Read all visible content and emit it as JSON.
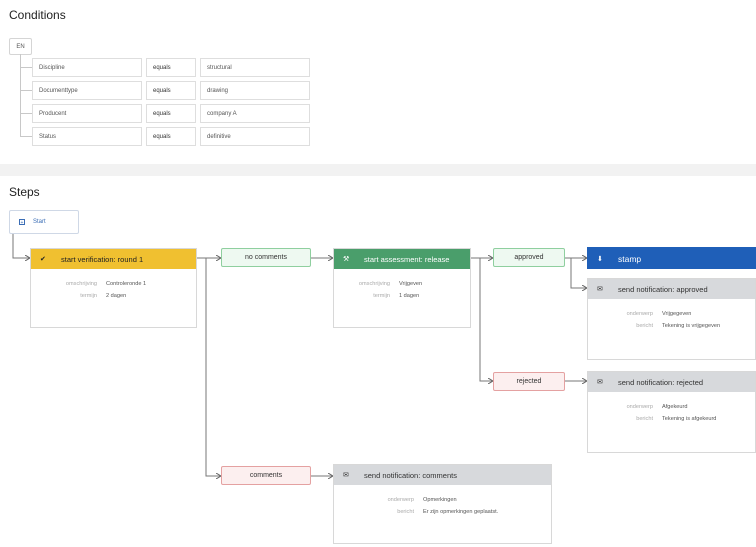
{
  "conditions": {
    "title": "Conditions",
    "operator": "EN",
    "rows": [
      {
        "field": "Discipline",
        "op": "equals",
        "value": "structural"
      },
      {
        "field": "Documenttype",
        "op": "equals",
        "value": "drawing"
      },
      {
        "field": "Producent",
        "op": "equals",
        "value": "company A"
      },
      {
        "field": "Status",
        "op": "equals",
        "value": "definitive"
      }
    ]
  },
  "steps": {
    "title": "Steps",
    "start_label": "Start",
    "verification": {
      "title": "start verification: round 1",
      "rows": [
        {
          "k": "omschrijving",
          "v": "Controleronde 1"
        },
        {
          "k": "termijn",
          "v": "2 dagen"
        }
      ]
    },
    "no_comments": "no comments",
    "comments": "comments",
    "assessment": {
      "title": "start assessment: release",
      "rows": [
        {
          "k": "omschrijving",
          "v": "Vrijgeven"
        },
        {
          "k": "termijn",
          "v": "1 dagen"
        }
      ]
    },
    "approved": "approved",
    "rejected": "rejected",
    "stamp": {
      "title": "stamp"
    },
    "notif_approved": {
      "title": "send notification: approved",
      "rows": [
        {
          "k": "onderwerp",
          "v": "Vrijgegeven"
        },
        {
          "k": "bericht",
          "v": "Tekening is vrijgegeven"
        }
      ]
    },
    "notif_rejected": {
      "title": "send notification: rejected",
      "rows": [
        {
          "k": "onderwerp",
          "v": "Afgekeurd"
        },
        {
          "k": "bericht",
          "v": "Tekening is afgekeurd"
        }
      ]
    },
    "notif_comments": {
      "title": "send notification: comments",
      "rows": [
        {
          "k": "onderwerp",
          "v": "Opmerkingen"
        },
        {
          "k": "bericht",
          "v": "Er zijn opmerkingen geplaatst."
        }
      ]
    }
  },
  "colors": {
    "verification": "#f0c030",
    "assessment": "#4a9e6b",
    "stamp": "#1f5fb8",
    "notification": "#d7d9dc"
  }
}
